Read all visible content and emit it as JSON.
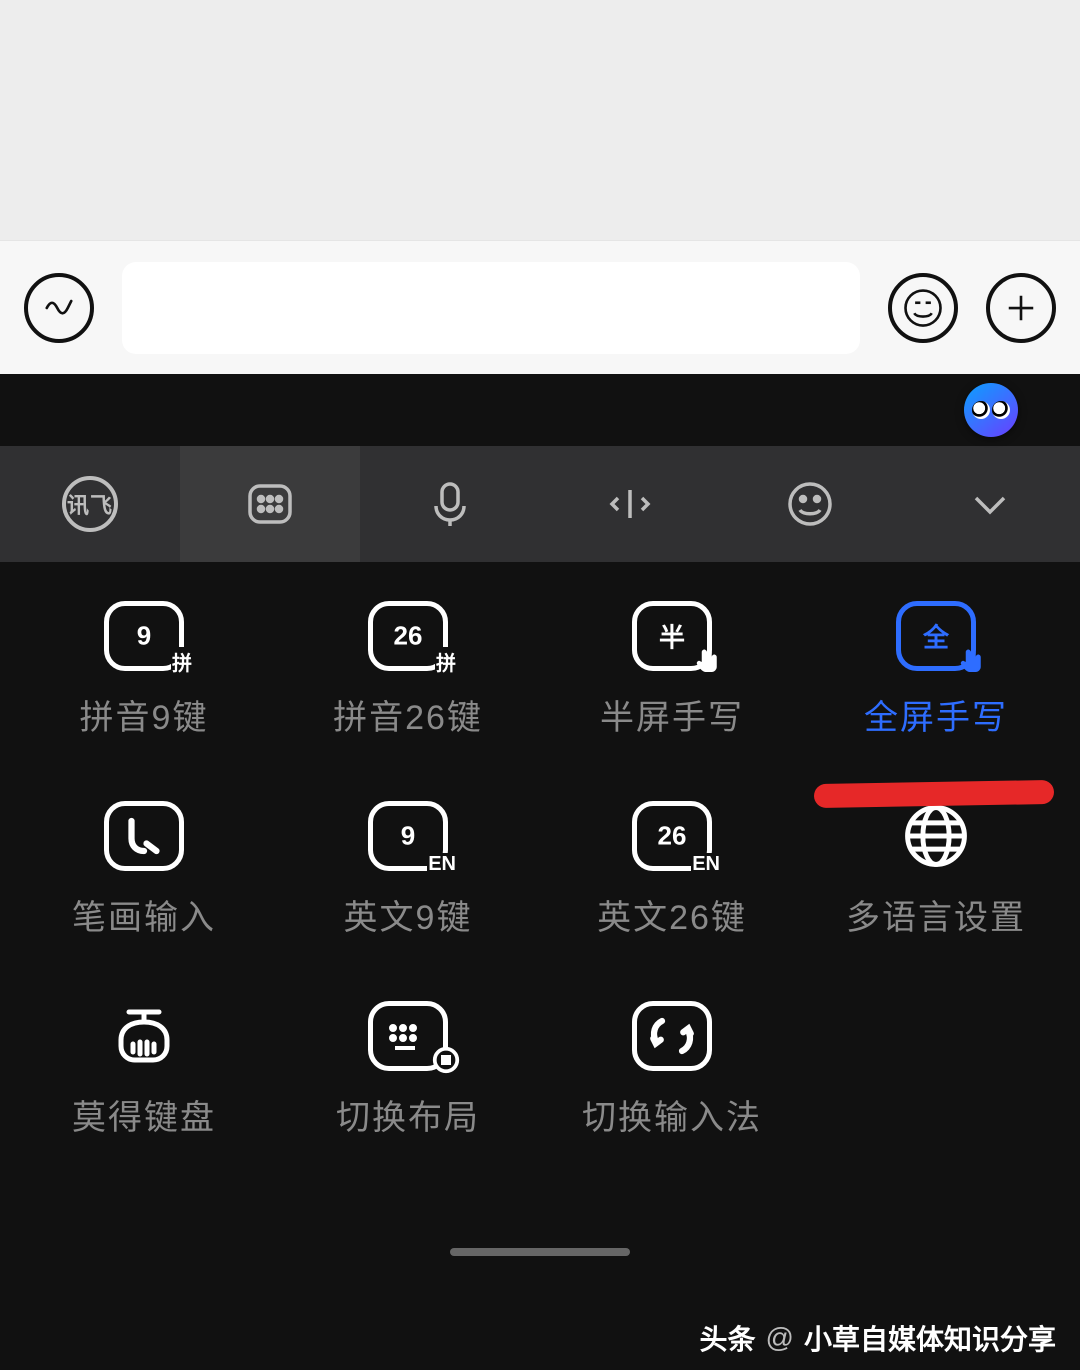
{
  "inputBar": {
    "voiceIcon": "voice",
    "emojiIcon": "emoji",
    "plusIcon": "plus",
    "inputValue": ""
  },
  "toolbar": {
    "items": [
      {
        "name": "logo",
        "label": "讯飞"
      },
      {
        "name": "keyboard-menu",
        "active": true
      },
      {
        "name": "voice-input"
      },
      {
        "name": "cursor-move"
      },
      {
        "name": "emoji-panel"
      },
      {
        "name": "collapse"
      }
    ]
  },
  "layouts": {
    "row1": [
      {
        "name": "pinyin9",
        "icon_main": "9",
        "icon_sub": "拼",
        "label": "拼音9键",
        "active": false
      },
      {
        "name": "pinyin26",
        "icon_main": "26",
        "icon_sub": "拼",
        "label": "拼音26键",
        "active": false
      },
      {
        "name": "half-handwrite",
        "icon_main": "半",
        "icon_sub": "hand",
        "label": "半屏手写",
        "active": false
      },
      {
        "name": "full-handwrite",
        "icon_main": "全",
        "icon_sub": "hand",
        "label": "全屏手写",
        "active": true
      }
    ],
    "row2": [
      {
        "name": "stroke-input",
        "icon_type": "stroke",
        "label": "笔画输入",
        "active": false
      },
      {
        "name": "english9",
        "icon_main": "9",
        "icon_sub": "EN",
        "label": "英文9键",
        "active": false
      },
      {
        "name": "english26",
        "icon_main": "26",
        "icon_sub": "EN",
        "label": "英文26键",
        "active": false
      },
      {
        "name": "multilang",
        "icon_type": "globe",
        "label": "多语言设置",
        "active": false
      }
    ],
    "row3": [
      {
        "name": "mode-keyboard",
        "icon_type": "pot",
        "label": "莫得键盘",
        "active": false
      },
      {
        "name": "switch-layout",
        "icon_type": "kb-switch",
        "label": "切换布局",
        "active": false
      },
      {
        "name": "switch-ime",
        "icon_type": "switch",
        "label": "切换输入法",
        "active": false
      }
    ]
  },
  "watermark": {
    "brand": "头条",
    "at": "@",
    "author": "小草自媒体知识分享"
  }
}
